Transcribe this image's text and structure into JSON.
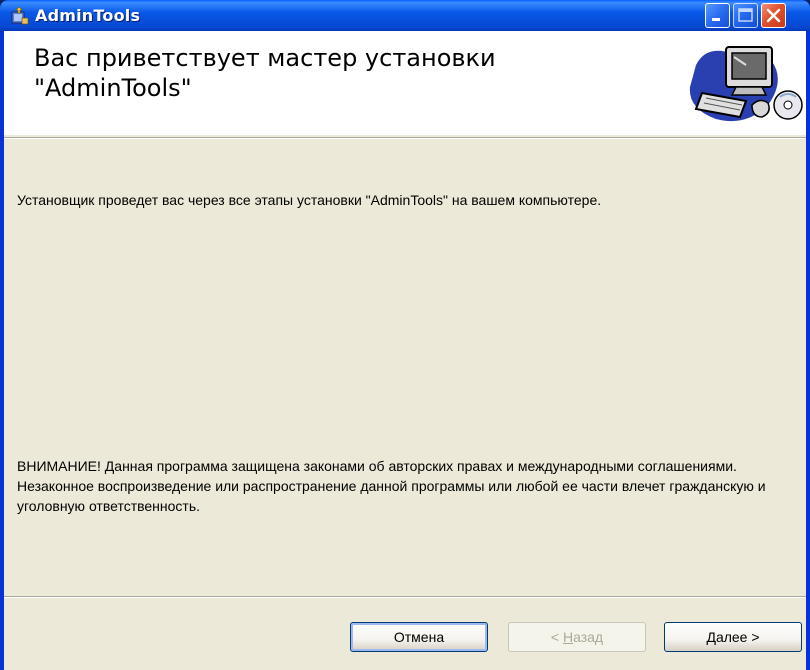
{
  "window": {
    "title": "AdminTools"
  },
  "banner": {
    "title_line1": "Вас приветствует мастер установки",
    "title_line2": "\"AdminTools\""
  },
  "body": {
    "intro": "Установщик проведет вас через все этапы установки \"AdminTools\" на вашем компьютере.",
    "warning": "ВНИМАНИЕ! Данная программа защищена законами об авторских правах и международными соглашениями. Незаконное воспроизведение или распространение данной программы или любой ее части влечет гражданскую и уголовную ответственность."
  },
  "buttons": {
    "cancel": "Отмена",
    "back_mnemonic": "Н",
    "back_rest": "азад",
    "back_prefix": "< ",
    "next_mnemonic": "Д",
    "next_rest": "алее",
    "next_suffix": " >"
  },
  "icons": {
    "app": "installer-icon",
    "minimize": "minimize-icon",
    "maximize": "maximize-icon",
    "close": "close-icon",
    "banner": "computer-setup-icon"
  },
  "colors": {
    "titlebar": "#0a58e8",
    "client_bg": "#ece9d8",
    "close_button": "#e0502a"
  }
}
